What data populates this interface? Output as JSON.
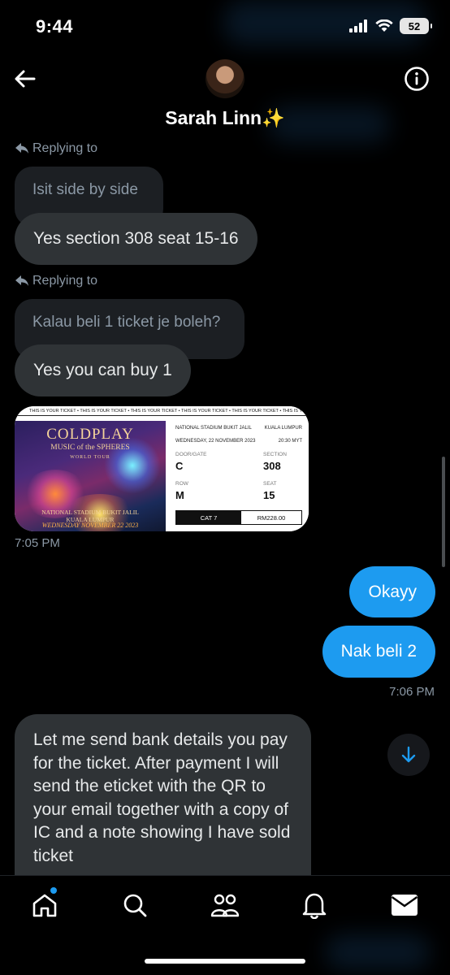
{
  "status_bar": {
    "time": "9:44",
    "battery": "52",
    "icons": [
      "cellular-signal-icon",
      "wifi-icon",
      "battery-icon"
    ]
  },
  "header": {
    "contact_name": "Sarah Linn✨",
    "back_icon": "back-arrow-icon",
    "info_icon": "info-icon"
  },
  "messages": {
    "reply_label": "Replying to",
    "quoted_1": "Isit side by side",
    "incoming_1": "Yes section 308 seat 15-16",
    "quoted_2": "Kalau beli 1 ticket je boleh?",
    "incoming_2": "Yes you can buy 1",
    "time_1": "7:05 PM",
    "outgoing_1": "Okayy",
    "outgoing_2": "Nak beli 2",
    "time_2": "7:06 PM",
    "incoming_3": "Let me send bank details you pay for the ticket. After payment I will send the eticket with the QR to your email together with a copy of IC and a note showing I have sold ticket"
  },
  "ticket": {
    "strip_text": "THIS IS YOUR TICKET • THIS IS YOUR TICKET • THIS IS YOUR TICKET • THIS IS YOUR TICKET • THIS IS YOUR TICKET • THIS IS YOUR TICKET • THIS IS YOUR TICKET • THIS IS YOUR TICKET",
    "band": "COLDPLAY",
    "tour_name": "MUSIC of the SPHERES",
    "tour_label": "WORLD TOUR",
    "venue_line1": "NATIONAL STADIUM BUKIT JALIL",
    "venue_line2": "KUALA LUMPUR",
    "date_line": "WEDNESDAY NOVEMBER 22 2023",
    "right_venue": "NATIONAL STADIUM BUKIT JALIL",
    "right_city": "KUALA LUMPUR",
    "right_date": "WEDNESDAY, 22 NOVEMBER 2023",
    "right_time": "20:30 MYT",
    "door_label": "DOOR/GATE",
    "door_value": "C",
    "section_label": "SECTION",
    "section_value": "308",
    "row_label": "ROW",
    "row_value": "M",
    "seat_label": "SEAT",
    "seat_value": "15",
    "category": "CAT 7",
    "price": "RM228.00"
  },
  "bottom_nav": {
    "items": [
      "home-icon",
      "search-icon",
      "communities-icon",
      "notifications-icon",
      "messages-icon"
    ],
    "active": "home-icon"
  },
  "colors": {
    "background": "#000000",
    "incoming_bubble": "#2f3336",
    "outgoing_bubble": "#1d9bf0",
    "muted_text": "#8b98a5"
  }
}
